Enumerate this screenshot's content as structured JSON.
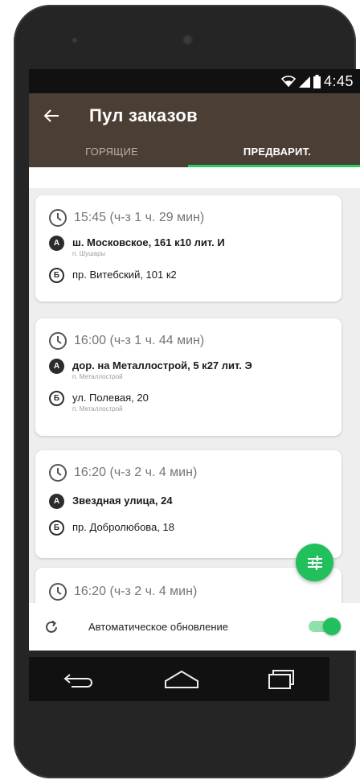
{
  "status_bar": {
    "time": "4:45",
    "icons": [
      "wifi-icon",
      "signal-icon",
      "battery-icon"
    ]
  },
  "header": {
    "title": "Пул заказов",
    "back_icon": "arrow-left-icon"
  },
  "tabs": [
    {
      "label": "ГОРЯЩИЕ",
      "active": false
    },
    {
      "label": "ПРЕДВАРИТ.",
      "active": true
    }
  ],
  "orders": [
    {
      "time": "15:45 (ч-з 1 ч. 29 мин)",
      "from": {
        "badge": "А",
        "address": "ш. Московское, 161 к10 лит. И",
        "locality": "п. Шушары"
      },
      "to": {
        "badge": "Б",
        "address": "пр. Витебский, 101 к2",
        "locality": ""
      }
    },
    {
      "time": "16:00 (ч-з 1 ч. 44 мин)",
      "from": {
        "badge": "А",
        "address": "дор. на Металлострой, 5 к27 лит. Э",
        "locality": "п. Металлострой"
      },
      "to": {
        "badge": "Б",
        "address": "ул. Полевая, 20",
        "locality": "п. Металлострой"
      }
    },
    {
      "time": "16:20 (ч-з 2 ч. 4 мин)",
      "from": {
        "badge": "А",
        "address": "Звездная улица, 24",
        "locality": ""
      },
      "to": {
        "badge": "Б",
        "address": "пр. Добролюбова, 18",
        "locality": ""
      }
    },
    {
      "time": "16:20 (ч-з 2 ч. 4 мин)"
    }
  ],
  "fab": {
    "icon": "filter-sliders-icon"
  },
  "bottom_bar": {
    "label": "Автоматическое обновление",
    "toggle_on": true
  },
  "colors": {
    "app_bar": "#4b3f35",
    "accent": "#22c05c",
    "status_bar": "#111111",
    "content_bg": "#eeeeee"
  }
}
